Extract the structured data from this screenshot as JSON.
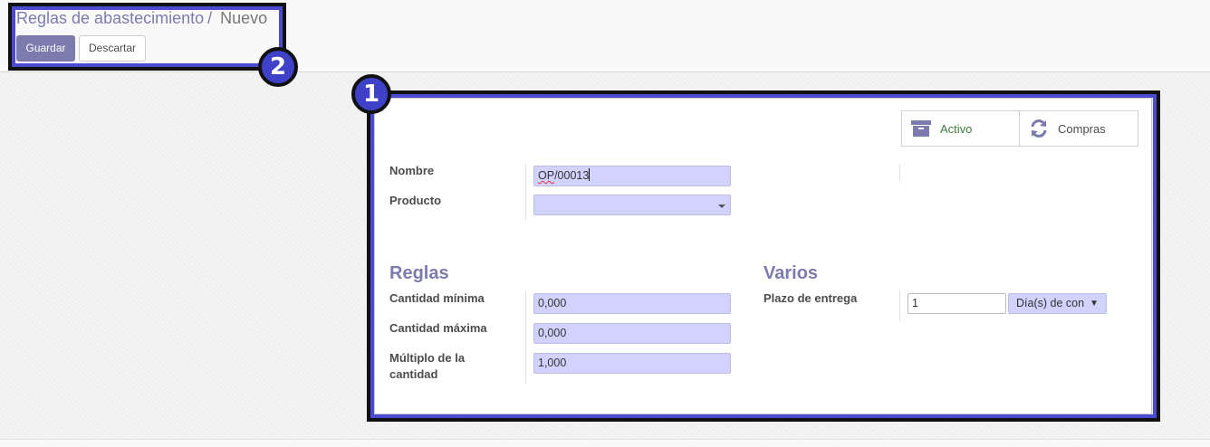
{
  "breadcrumb": {
    "parent": "Reglas de abastecimiento",
    "separator": "/",
    "current": "Nuevo"
  },
  "toolbar": {
    "save_label": "Guardar",
    "discard_label": "Descartar"
  },
  "callouts": {
    "form": "1",
    "header": "2"
  },
  "button_box": {
    "active_label": "Activo",
    "active_icon": "archive-icon",
    "purchase_label": "Compras",
    "purchase_icon": "refresh-icon"
  },
  "form": {
    "name_label": "Nombre",
    "name_value_prefix": "OP",
    "name_value_suffix": "/00013",
    "product_label": "Producto",
    "product_value": ""
  },
  "rules": {
    "title": "Reglas",
    "min_label": "Cantidad mínima",
    "min_value": "0,000",
    "max_label": "Cantidad máxima",
    "max_value": "0,000",
    "multiple_label_line1": "Múltiplo de la",
    "multiple_label_line2": "cantidad",
    "multiple_value": "1,000"
  },
  "misc": {
    "title": "Varios",
    "lead_label": "Plazo de entrega",
    "lead_value": "1",
    "lead_unit": "Día(s) de con",
    "lead_unit_arrow": "▼"
  },
  "colors": {
    "brand": "#7c7bad",
    "highlight_border": "#4b4bd1",
    "callout_fill": "#3f41c8",
    "required_field": "#d2d2ff"
  }
}
